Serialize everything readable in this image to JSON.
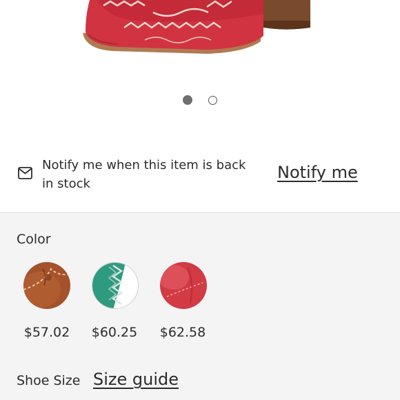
{
  "carousel": {
    "slide_count": 2,
    "active_index": 0
  },
  "notify": {
    "icon": "envelope-icon",
    "message": "Notify me when this item is back in stock",
    "link_label": "Notify me"
  },
  "color": {
    "label": "Color",
    "swatches": [
      {
        "name": "brown",
        "price": "$57.02",
        "color": "#a5512a"
      },
      {
        "name": "teal",
        "price": "$60.25",
        "color": "#2e9a80"
      },
      {
        "name": "red",
        "price": "$62.58",
        "color": "#d23a44"
      }
    ]
  },
  "size": {
    "label": "Shoe Size",
    "guide_label": "Size guide"
  },
  "colors": {
    "accent_text": "#2b2b2b",
    "section_bg": "#f4f4f4",
    "product_red": "#d13340",
    "heel_brown": "#7a4a2c"
  }
}
